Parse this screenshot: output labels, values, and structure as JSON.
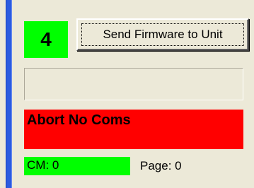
{
  "unit": {
    "number": "4"
  },
  "toolbar": {
    "send_firmware_label": "Send Firmware to Unit"
  },
  "status": {
    "message": "",
    "abort_text": "Abort No Coms",
    "cm_text": "CM: 0",
    "page_text": "Page: 0"
  },
  "colors": {
    "ok": "#00ff00",
    "error": "#ff0000",
    "rail": "#2b5be0",
    "background": "#ece9d8"
  }
}
